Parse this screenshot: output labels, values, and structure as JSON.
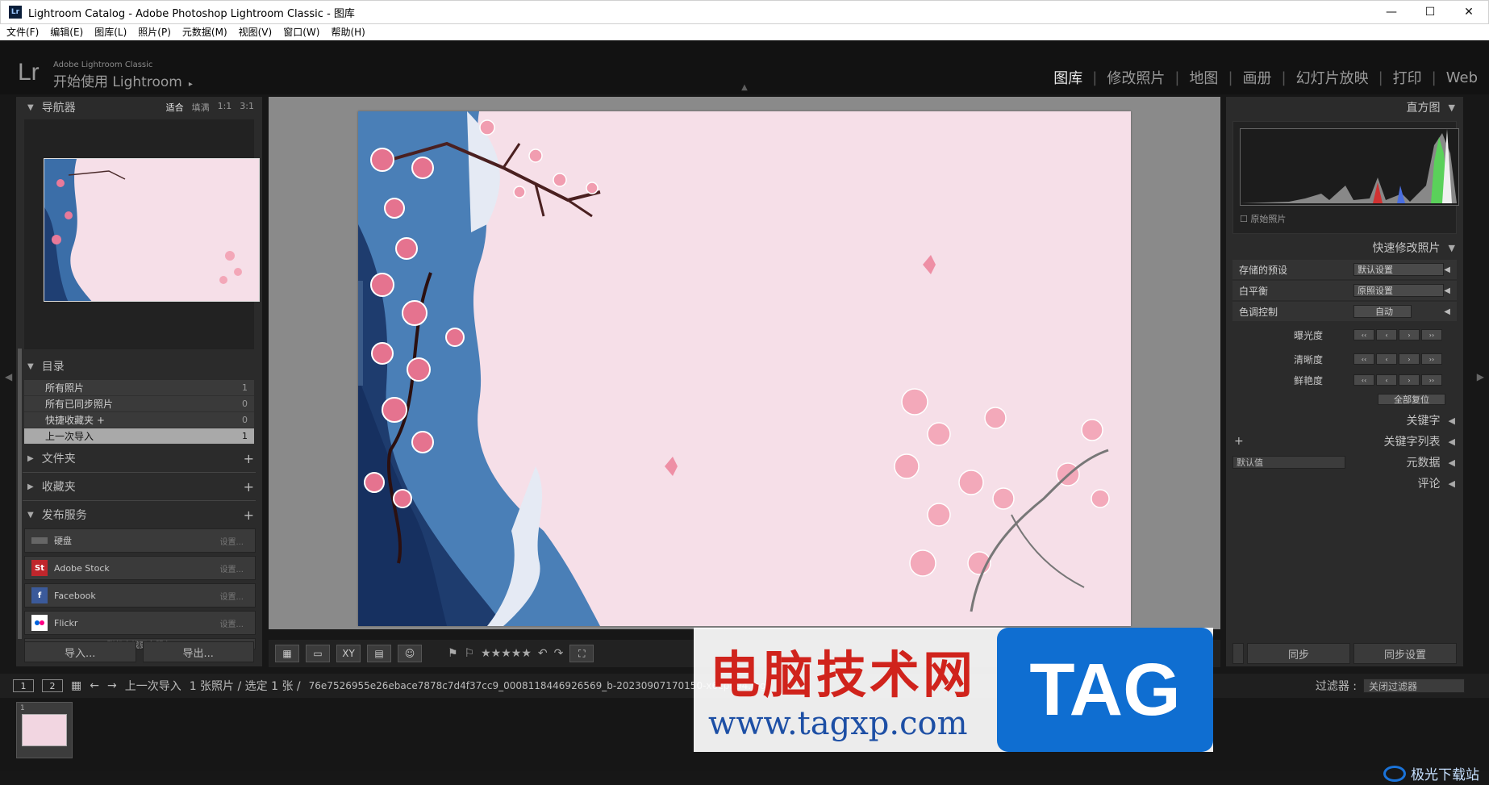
{
  "window": {
    "title": "Lightroom Catalog - Adobe Photoshop Lightroom Classic - 图库",
    "app_icon": "Lr",
    "minimize": "—",
    "maximize": "☐",
    "close": "✕"
  },
  "menu": [
    "文件(F)",
    "编辑(E)",
    "图库(L)",
    "照片(P)",
    "元数据(M)",
    "视图(V)",
    "窗口(W)",
    "帮助(H)"
  ],
  "identity": {
    "logo": "Lr",
    "small": "Adobe Lightroom Classic",
    "main": "开始使用 Lightroom",
    "arrow": "▸"
  },
  "modules": {
    "items": [
      "图库",
      "修改照片",
      "地图",
      "画册",
      "幻灯片放映",
      "打印",
      "Web"
    ],
    "active": "图库"
  },
  "navigator": {
    "title": "导航器",
    "zoom": [
      "适合",
      "填满",
      "1:1",
      "3:1"
    ]
  },
  "catalog": {
    "title": "目录",
    "rows": [
      {
        "label": "所有照片",
        "count": "1"
      },
      {
        "label": "所有已同步照片",
        "count": "0"
      },
      {
        "label": "快捷收藏夹 +",
        "count": "0"
      },
      {
        "label": "上一次导入",
        "count": "1"
      }
    ]
  },
  "folders": {
    "title": "文件夹"
  },
  "collections": {
    "title": "收藏夹"
  },
  "publish": {
    "title": "发布服务",
    "rows": [
      {
        "label": "硬盘",
        "setting": "设置..."
      },
      {
        "label": "Adobe Stock",
        "setting": "设置..."
      },
      {
        "label": "Facebook",
        "setting": "设置..."
      },
      {
        "label": "Flickr",
        "setting": "设置..."
      }
    ],
    "more": "联机查找更多服务..."
  },
  "left_buttons": {
    "import": "导入...",
    "export": "导出..."
  },
  "histogram": {
    "title": "直方图",
    "original": "原始照片"
  },
  "quick_develop": {
    "title": "快速修改照片",
    "preset_label": "存储的预设",
    "preset_value": "默认设置",
    "wb_label": "白平衡",
    "wb_value": "原照设置",
    "tone_label": "色调控制",
    "tone_value": "自动",
    "exposure": "曝光度",
    "clarity": "清晰度",
    "vibrance": "鲜艳度",
    "reset": "全部复位"
  },
  "right_sections": {
    "keywording": "关键字",
    "keyword_list": "关键字列表",
    "metadata_preset": "默认值",
    "metadata": "元数据",
    "comments": "评论"
  },
  "right_buttons": {
    "sync": "同步",
    "sync_settings": "同步设置"
  },
  "toolbar": {
    "stars": "★★★★★"
  },
  "filmstrip": {
    "page1": "1",
    "page2": "2",
    "source": "上一次导入",
    "info": "1 张照片 / 选定 1 张 /",
    "filename": "76e7526955e26ebace7878c7d4f37cc9_0008118446926569_b-20230907170150-x6cpn94.jpg",
    "filter_label": "过滤器 :",
    "filter_value": "关闭过滤器",
    "thumb_index": "1"
  },
  "watermark": {
    "cn": "电脑技术网",
    "url": "www.tagxp.com",
    "tag": "TAG",
    "site": "极光下载站"
  }
}
